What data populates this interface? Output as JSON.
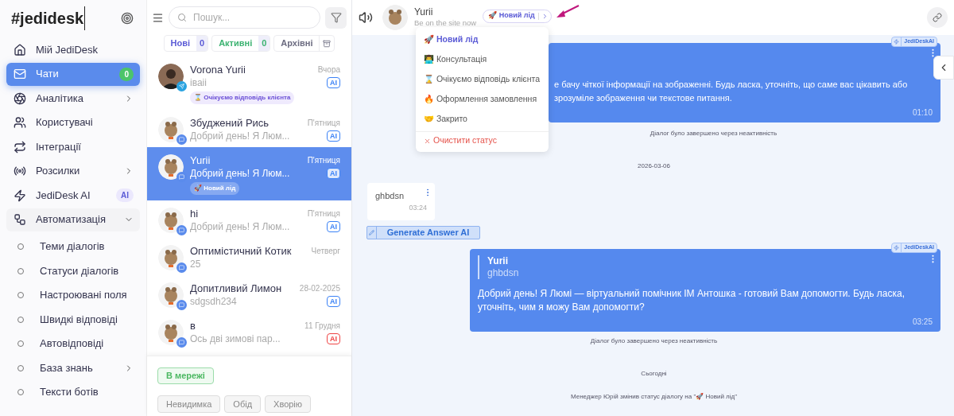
{
  "brand": {
    "name": "#jedidesk"
  },
  "sidebar": {
    "items": [
      {
        "label": "Мій JediDesk",
        "selected": false
      },
      {
        "label": "Чати",
        "selected": true,
        "badge": "0"
      },
      {
        "label": "Аналітика",
        "selected": false,
        "expanded": false
      },
      {
        "label": "Користувачі",
        "selected": false
      },
      {
        "label": "Інтеграції",
        "selected": false
      },
      {
        "label": "Розсилки",
        "selected": false,
        "expanded": false
      },
      {
        "label": "JediDesk AI",
        "selected": false,
        "badge": "AI"
      },
      {
        "label": "Автоматизація",
        "selected": false,
        "expanded": true,
        "children": [
          {
            "label": "Теми діалогів",
            "selected": false
          },
          {
            "label": "Статуси діалогів",
            "selected": false
          },
          {
            "label": "Настроювані поля",
            "selected": false
          },
          {
            "label": "Швидкі відповіді",
            "selected": false
          },
          {
            "label": "Автовідповіді",
            "selected": false
          },
          {
            "label": "База знань",
            "selected": false,
            "expanded": false
          },
          {
            "label": "Тексти ботів",
            "selected": false
          }
        ]
      }
    ]
  },
  "chat_list": {
    "search": {
      "placeholder": "Пошук..."
    },
    "filters": [
      {
        "label": "Нові",
        "count": "0",
        "color": "#5b5bd6"
      },
      {
        "label": "Активні",
        "count": "0",
        "color": "#3cb371"
      },
      {
        "label": "Архівні",
        "color": "#6b6b80"
      }
    ],
    "chats": [
      {
        "name": "Vorona Yurii",
        "preview": "iваii",
        "time": "Вчора",
        "badge": {
          "text": "AI",
          "color": "#3b82f6"
        },
        "tag": "⌛ Очікуємо відповідь клієнта",
        "selected": false
      },
      {
        "name": "Збуджений Рись",
        "preview": "Добрий день! Я Люм...",
        "time": "П'ятниця",
        "badge": {
          "text": "AI",
          "color": "#3b82f6"
        },
        "selected": false
      },
      {
        "name": "Yurii",
        "preview": "Добрий день! Я Люм...",
        "time": "П'ятниця",
        "badge": {
          "text": "AI",
          "color": "#3b82f6"
        },
        "tag": "🚀 Новий лід",
        "selected": true
      },
      {
        "name": "hi",
        "preview": "Добрий день! Я Люм...",
        "time": "П'ятниця",
        "badge": {
          "text": "AI",
          "color": "#3b82f6"
        },
        "selected": false
      },
      {
        "name": "Оптимістичний Котик",
        "preview": "25",
        "time": "Четверг",
        "selected": false
      },
      {
        "name": "Допитливий Лимон",
        "preview": "sdgsdh234",
        "time": "28-02-2025",
        "badge": {
          "text": "AI",
          "color": "#3b82f6"
        },
        "selected": false
      },
      {
        "name": "в",
        "preview": "Ось дві зимові пар...",
        "time": "11 Грудня",
        "badge": {
          "text": "AI",
          "color": "#ef4444"
        },
        "selected": false
      }
    ],
    "presence": {
      "current": "В мережі",
      "options": [
        "Невидимка",
        "Обід",
        "Хворію"
      ]
    }
  },
  "header": {
    "name": "Yurii",
    "subtitle": "Be on the site now",
    "status": "🚀 Новий лід"
  },
  "status_menu": [
    {
      "label": "🚀 Новий лід",
      "kind": "status",
      "selected": true
    },
    {
      "label": "👨‍💻 Консультація",
      "kind": "status",
      "selected": false
    },
    {
      "label": "⌛ Очікуємо відповідь клієнта",
      "kind": "status",
      "selected": false
    },
    {
      "label": "🔥 Оформлення замовлення",
      "kind": "status",
      "selected": false
    },
    {
      "label": "🤝 Закрито",
      "kind": "status",
      "selected": false
    },
    {
      "label": "Очистити статус",
      "kind": "clear",
      "selected": false
    }
  ],
  "messages": [
    {
      "kind": "bot_partial",
      "badge": "JediDeskAI",
      "lines": [
        "е бачу чіткої інформації на зображенні. Будь ласка, уточніть, що саме вас цікавить або",
        "зрозуміле зображення чи текстове питання."
      ],
      "time": "01:10"
    },
    {
      "kind": "system",
      "text": "Діалог було завершено через неактивність"
    },
    {
      "kind": "date",
      "text": "2026-03-06"
    },
    {
      "kind": "client",
      "text": "ghbdsn",
      "time": "03:24"
    },
    {
      "kind": "action",
      "text": "Generate Answer AI"
    },
    {
      "kind": "bot",
      "badge": "JediDeskAI",
      "quote": {
        "name": "Yurii",
        "text": "ghbdsn"
      },
      "text": "Добрий день! Я Люмі — віртуальний помічник ІМ Антошка - готовий Вам допомогти. Будь ласка, уточніть, чим я можу Вам допомогти?",
      "time": "03:25"
    },
    {
      "kind": "system",
      "text": "Діалог було завершено через неактивність"
    },
    {
      "kind": "date",
      "text": "Сьогодні"
    },
    {
      "kind": "system",
      "text": "Менеджер Юрій змінив статус діалогу на \"🚀 Новий лід\""
    }
  ]
}
